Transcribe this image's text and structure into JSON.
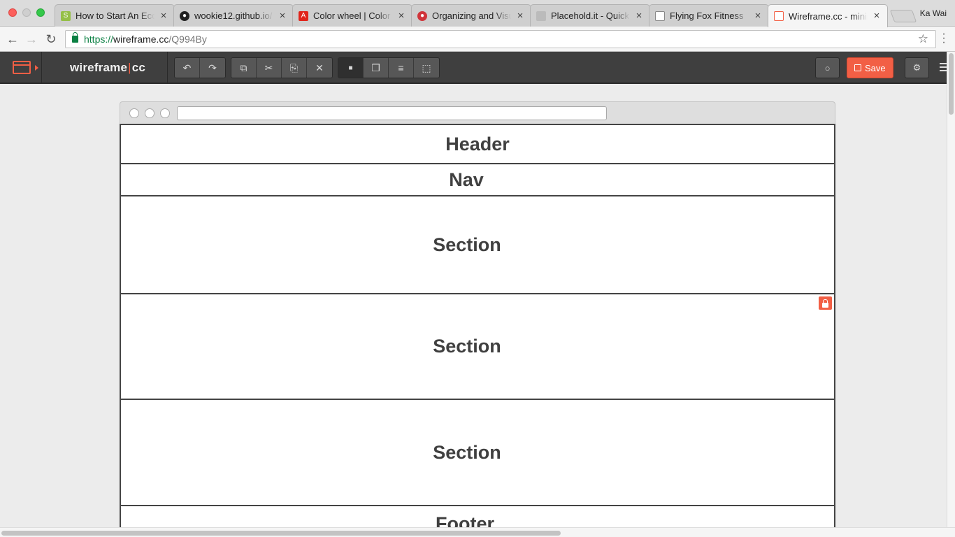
{
  "browser": {
    "tabs": [
      {
        "title": "How to Start An Ecommerce",
        "favicon": "shopify-icon",
        "color": "#95bf47"
      },
      {
        "title": "wookie12.github.io/",
        "favicon": "github-icon",
        "color": "#222222"
      },
      {
        "title": "Color wheel | Color",
        "favicon": "adobe-icon",
        "color": "#e1251b"
      },
      {
        "title": "Organizing and Visualizing",
        "favicon": "site-icon",
        "color": "#d0343a"
      },
      {
        "title": "Placehold.it - Quick",
        "favicon": "placehold-icon",
        "color": "#bbbbbb"
      },
      {
        "title": "Flying Fox Fitness",
        "favicon": "document-icon",
        "color": "#888888"
      },
      {
        "title": "Wireframe.cc - minimal",
        "favicon": "wireframe-icon",
        "color": "#f25f45"
      }
    ],
    "close_glyph": "×",
    "profile_name": "Ka Wai",
    "url": {
      "scheme": "https://",
      "host": "wireframe.cc",
      "path": "/Q994By"
    }
  },
  "app": {
    "brand_left": "wireframe",
    "brand_sep": "|",
    "brand_right": "cc",
    "save_label": "Save",
    "accent": "#f25f45",
    "toolbar_icons": {
      "undo": "↶",
      "redo": "↷",
      "duplicate": "⧉",
      "cut": "✂",
      "paste": "⎘",
      "delete": "✕",
      "lock": "🔒",
      "arrange": "❐",
      "align": "≡",
      "group": "⬚",
      "comment": "💬",
      "settings": "⚙"
    }
  },
  "wireframe": {
    "blocks": [
      {
        "label": "Header",
        "locked": false
      },
      {
        "label": "Nav",
        "locked": false
      },
      {
        "label": "Section",
        "locked": false
      },
      {
        "label": "Section",
        "locked": true
      },
      {
        "label": "Section",
        "locked": false
      },
      {
        "label": "Footer",
        "locked": false
      }
    ]
  }
}
